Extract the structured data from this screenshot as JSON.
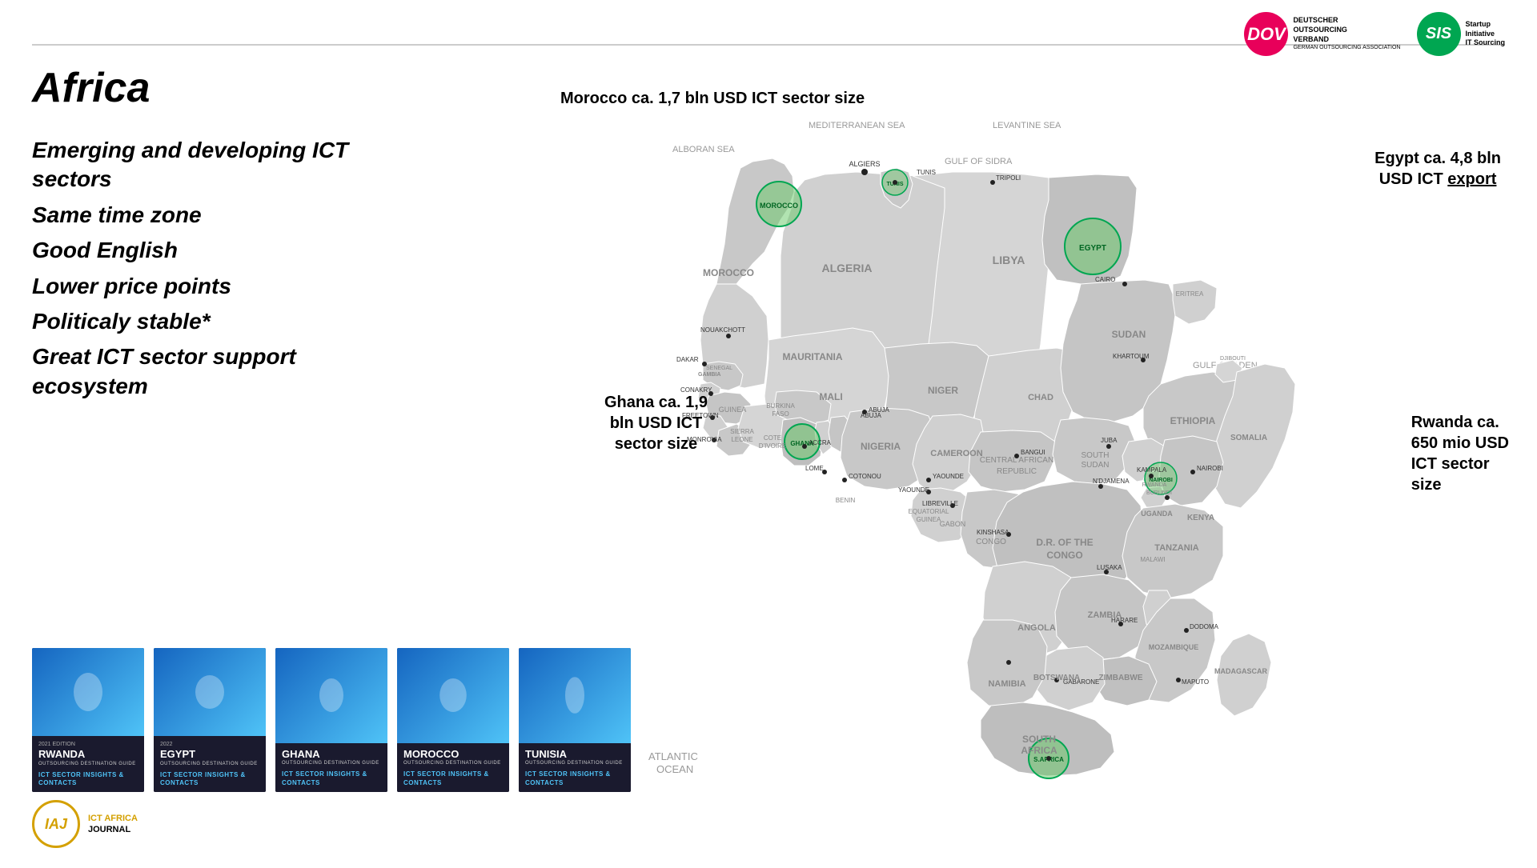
{
  "header": {
    "dov": {
      "abbr": "DOV",
      "line1": "DEUTSCHER",
      "line2": "OUTSOURCING",
      "line3": "VERBAND",
      "line4": "GERMAN OUTSOURCING ASSOCIATION"
    },
    "sis": {
      "abbr": "SIS",
      "line1": "Startup",
      "line2": "Initiative",
      "line3": "IT Sourcing"
    }
  },
  "title": "Africa",
  "bullets": [
    "Emerging and developing ICT sectors",
    "Same time zone",
    "Good English",
    "Lower price points",
    "Politicaly stable*",
    "Great ICT sector support ecosystem"
  ],
  "map_labels": {
    "morocco": "Morocco ca. 1,7\nbln USD ICT\nsector size",
    "egypt": "Egypt ca. 4,8 bln\nUSD ICT export",
    "ghana": "Ghana ca. 1,9\nbln USD ICT\nsector size",
    "rwanda": "Rwanda ca.\n650 mio USD\nICT sector\nsize"
  },
  "books": [
    {
      "country": "RWANDA",
      "year": "2021 EDITION",
      "subtitle": "OUTSOURCING DESTINATION GUIDE",
      "section": "ICT SECTOR INSIGHTS & CONTACTS",
      "bg_color": "#1e88c7"
    },
    {
      "country": "EGYPT",
      "year": "2022",
      "subtitle": "OUTSOURCING DESTINATION GUIDE",
      "section": "ICT SECTOR INSIGHTS & CONTACTS",
      "bg_color": "#1e88c7"
    },
    {
      "country": "GHANA",
      "year": "",
      "subtitle": "OUTSOURCING DESTINATION GUIDE",
      "section": "ICT SECTOR INSIGHTS & CONTACTS",
      "bg_color": "#1e88c7"
    },
    {
      "country": "MOROCCO",
      "year": "",
      "subtitle": "OUTSOURCING DESTINATION GUIDE",
      "section": "ICT SECTOR INSIGHTS & CONTACTS",
      "bg_color": "#1e88c7"
    },
    {
      "country": "TUNISIA",
      "year": "",
      "subtitle": "OUTSOURCING DESTINATION GUIDE",
      "section": "ICT SECTOR INSIGHTS & CONTACTS",
      "bg_color": "#1e88c7"
    }
  ],
  "iaj": {
    "abbr": "IAJ",
    "line1": "ICT AFRICA",
    "line2": "JOURNAL"
  }
}
